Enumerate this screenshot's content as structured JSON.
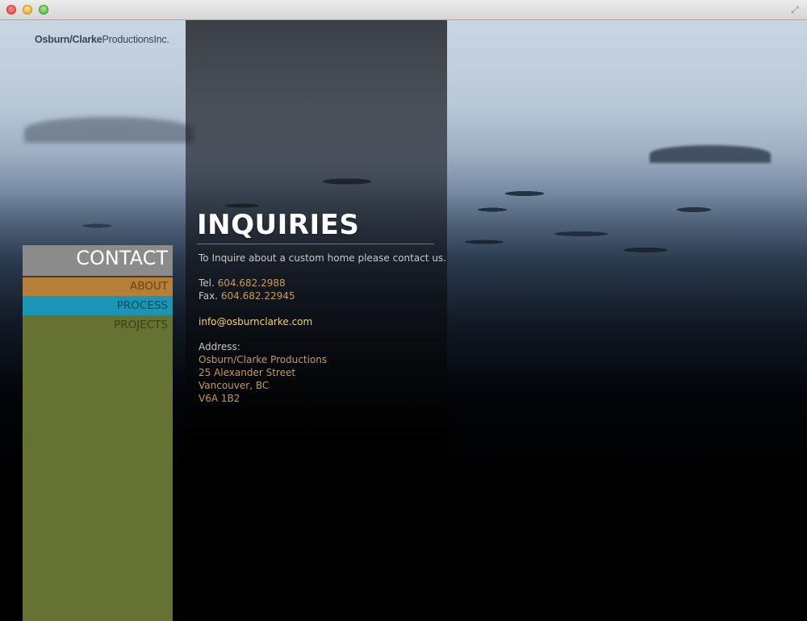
{
  "window": {
    "controls": {
      "close_icon": "close-icon",
      "minimize_icon": "minimize-icon",
      "zoom_icon": "zoom-icon",
      "fullscreen_icon": "fullscreen-icon"
    }
  },
  "logo": {
    "bold": "Osburn/Clarke",
    "regular": "ProductionsInc."
  },
  "nav": {
    "items": [
      {
        "label": "CONTACT",
        "color": "#8b8b8b",
        "active": true
      },
      {
        "label": "ABOUT",
        "color": "#b57f3a"
      },
      {
        "label": "PROCESS",
        "color": "#1a95b5"
      },
      {
        "label": "PROJECTS",
        "color": "#657232"
      }
    ]
  },
  "content": {
    "heading": "INQUIRIES",
    "intro": "To Inquire about a custom home please contact us.",
    "tel_label": "Tel.",
    "tel_value": "604.682.2988",
    "fax_label": "Fax.",
    "fax_value": "604.682.22945",
    "email": "info@osburnclarke.com",
    "address_label": "Address:",
    "address_lines": [
      "Osburn/Clarke Productions",
      "25 Alexander Street",
      "Vancouver, BC",
      "V6A 1B2"
    ]
  },
  "colors": {
    "accent": "#c89a5a",
    "email": "#f2d36a"
  }
}
